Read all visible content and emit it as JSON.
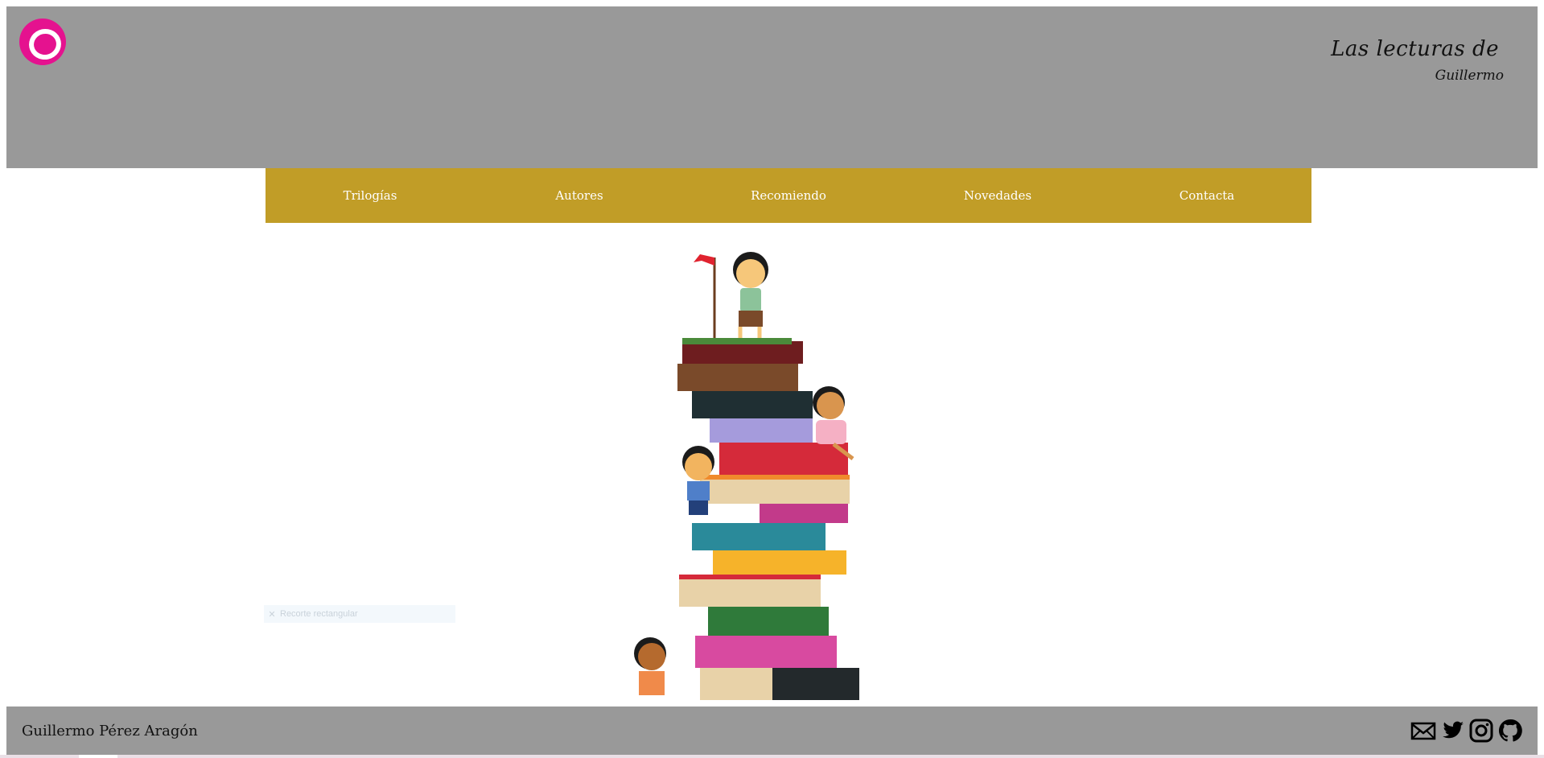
{
  "header": {
    "logo": {
      "icon": "circle-logo-icon",
      "color": "#e5128f"
    },
    "brand_line1": "Las lecturas de",
    "brand_line2": "Guillermo",
    "background": "#999999"
  },
  "nav": {
    "background": "#c19d27",
    "items": [
      {
        "label": "Trilogías"
      },
      {
        "label": "Autores"
      },
      {
        "label": "Recomiendo"
      },
      {
        "label": "Novedades"
      },
      {
        "label": "Contacta"
      }
    ]
  },
  "hero": {
    "image": "children-on-stack-of-books-illustration"
  },
  "overlay": {
    "icon": "close-icon",
    "label": "Recorte rectangular"
  },
  "footer": {
    "name": "Guillermo Pérez Aragón",
    "social": [
      {
        "icon": "mail-icon"
      },
      {
        "icon": "twitter-icon"
      },
      {
        "icon": "instagram-icon"
      },
      {
        "icon": "github-icon"
      }
    ]
  }
}
